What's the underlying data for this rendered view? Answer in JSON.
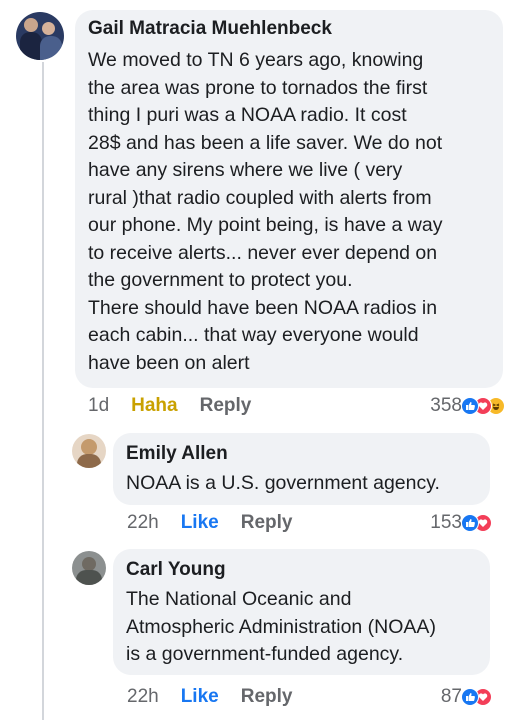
{
  "comment": {
    "author": "Gail Matracia Muehlenbeck",
    "text": "We moved to TN 6 years ago, knowing\nthe area was prone to tornados the first\nthing I puri was a NOAA radio. It cost\n28$ and has been a life saver. We do not\nhave any sirens where we live ( very\nrural )that radio coupled with alerts from\nour phone. My point being, is have a way\nto receive alerts... never ever depend on\nthe government to protect you.\nThere should have been NOAA radios in\neach cabin... that way everyone would\nhave been on alert",
    "time": "1d",
    "reaction_label": "Haha",
    "reply_label": "Reply",
    "reaction_count": "358",
    "reaction_icons": [
      "like-icon",
      "love-icon",
      "haha-icon"
    ]
  },
  "replies": [
    {
      "author": "Emily Allen",
      "text": "NOAA is a U.S. government agency.",
      "time": "22h",
      "like_label": "Like",
      "reply_label": "Reply",
      "reaction_count": "153",
      "reaction_icons": [
        "like-icon",
        "love-icon"
      ]
    },
    {
      "author": "Carl Young",
      "text": "The National Oceanic and\nAtmospheric Administration (NOAA)\nis a government-funded agency.",
      "time": "22h",
      "like_label": "Like",
      "reply_label": "Reply",
      "reaction_count": "87",
      "reaction_icons": [
        "like-icon",
        "love-icon"
      ]
    }
  ],
  "colors": {
    "bubble": "#f0f2f5",
    "like_blue": "#1877f2",
    "love_red": "#f33e58",
    "haha_yellow": "#f7b928",
    "meta_gray": "#65676b"
  }
}
